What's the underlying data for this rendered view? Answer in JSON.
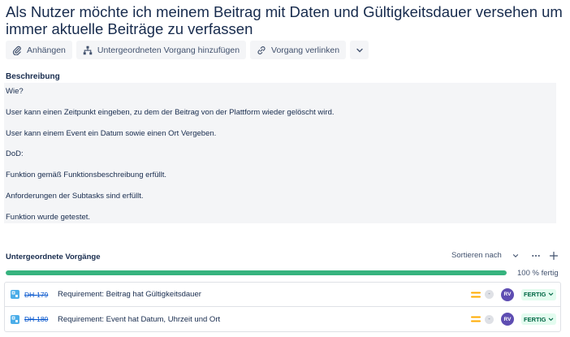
{
  "issue": {
    "title": "Als Nutzer möchte ich meinem Beitrag mit Daten und Gültigkeitsdauer versehen um immer aktuelle Beiträge zu verfassen"
  },
  "toolbar": {
    "attach_label": "Anhängen",
    "add_child_label": "Untergeordneten Vorgang hinzufügen",
    "link_label": "Vorgang verlinken"
  },
  "description": {
    "label": "Beschreibung",
    "lines": [
      "Wie?",
      "User kann einen Zeitpunkt eingeben, zu dem der Beitrag von der Plattform wieder gelöscht wird.",
      "User kann einem Event ein Datum sowie einen Ort Vergeben.",
      "DoD:",
      "Funktion gemäß Funktionsbeschreibung erfüllt.",
      "Anforderungen der Subtasks sind erfüllt.",
      "Funktion wurde getestet."
    ]
  },
  "subtasks": {
    "label": "Untergeordnete Vorgänge",
    "sort_label": "Sortieren nach",
    "progress": 1.0,
    "progress_label": "100 % fertig",
    "items": [
      {
        "key": "DH-179",
        "summary": "Requirement: Beitrag hat Gültigkeitsdauer",
        "estimate": "-",
        "assignee": "RV",
        "status": "FERTIG"
      },
      {
        "key": "DH-180",
        "summary": "Requirement: Event hat Datum, Uhrzeit und Ort",
        "estimate": "-",
        "assignee": "RV",
        "status": "FERTIG"
      }
    ]
  },
  "colors": {
    "progress": "#36b37e",
    "status_bg": "#e3fcef",
    "status_text": "#006644",
    "priority": "#ffab00",
    "avatar": "#5e4db2",
    "link": "#0052cc"
  }
}
